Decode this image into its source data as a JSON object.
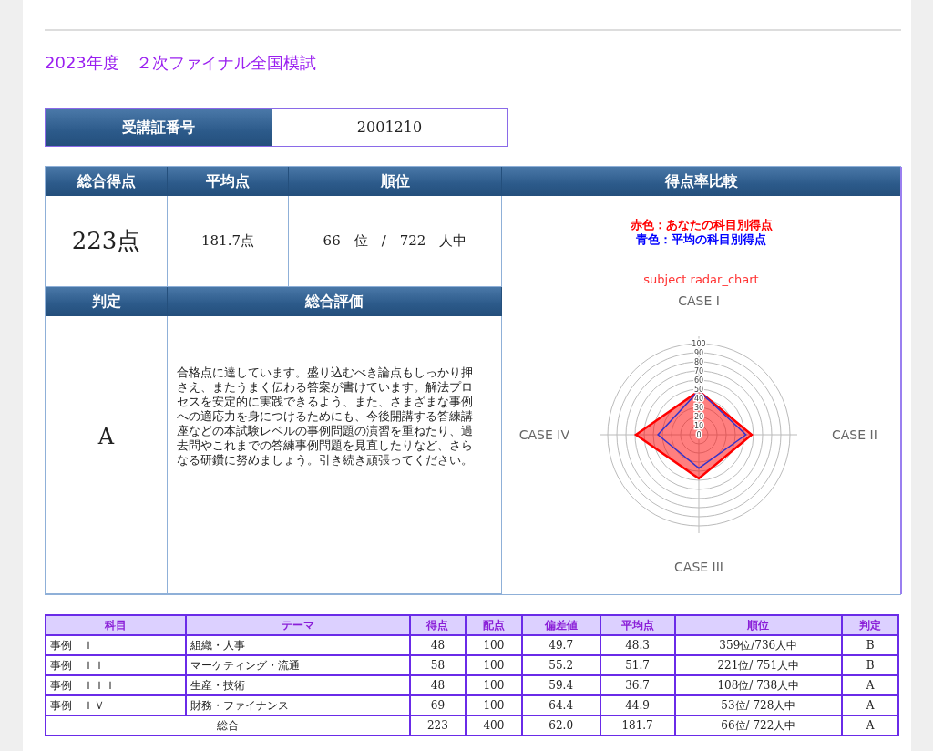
{
  "title": "2023年度　２次ファイナル全国模試",
  "id_field": {
    "label": "受講証番号",
    "value": "2001210"
  },
  "summary": {
    "total_label": "総合得点",
    "total": "223点",
    "average_label": "平均点",
    "average": "181.7点",
    "rank_label": "順位",
    "rank": "66　位　/　722　人中"
  },
  "judgement": {
    "label": "判定",
    "value": "A"
  },
  "evaluation": {
    "label": "総合評価",
    "text": "合格点に達しています。盛り込むべき論点もしっかり押さえ、またうまく伝わる答案が書けています。解法プロセスを安定的に実践できるよう、また、さまざまな事例への適応力を身につけるためにも、今後開講する答練講座などの本試験レベルの事例問題の演習を重ねたり、過去問やこれまでの答練事例問題を見直したりなど、さらなる研鑽に努めましょう。引き続き頑張ってください。"
  },
  "comparison": {
    "label": "得点率比較",
    "legend": [
      {
        "text": "赤色：あなたの科目別得点",
        "color": "#ff0000"
      },
      {
        "text": "青色：平均の科目別得点",
        "color": "#0000ff"
      }
    ],
    "radar_chart": {
      "title": "subject radar_chart",
      "axis_labels": [
        "CASE I",
        "CASE II",
        "CASE III",
        "CASE IV"
      ],
      "tick_labels": [
        "100",
        "90",
        "80",
        "70",
        "60",
        "50",
        "40",
        "30",
        "20",
        "10",
        "0"
      ]
    }
  },
  "results_table": {
    "columns": [
      "科目",
      "テーマ",
      "得点",
      "配点",
      "偏差値",
      "平均点",
      "順位",
      "判定"
    ],
    "rows": [
      [
        "事例　Ｉ",
        "組織・人事",
        "48",
        "100",
        "49.7",
        "48.3",
        "359位/736人中",
        "B"
      ],
      [
        "事例　ＩＩ",
        "マーケティング・流通",
        "58",
        "100",
        "55.2",
        "51.7",
        "221位/ 751人中",
        "B"
      ],
      [
        "事例　ＩＩＩ",
        "生産・技術",
        "48",
        "100",
        "59.4",
        "36.7",
        "108位/ 738人中",
        "A"
      ],
      [
        "事例　ＩＶ",
        "財務・ファイナンス",
        "69",
        "100",
        "64.4",
        "44.9",
        "53位/ 728人中",
        "A"
      ]
    ],
    "total_row": {
      "label": "総合",
      "cells": [
        "223",
        "400",
        "62.0",
        "181.7",
        "66位/ 722人中",
        "A"
      ]
    }
  }
}
